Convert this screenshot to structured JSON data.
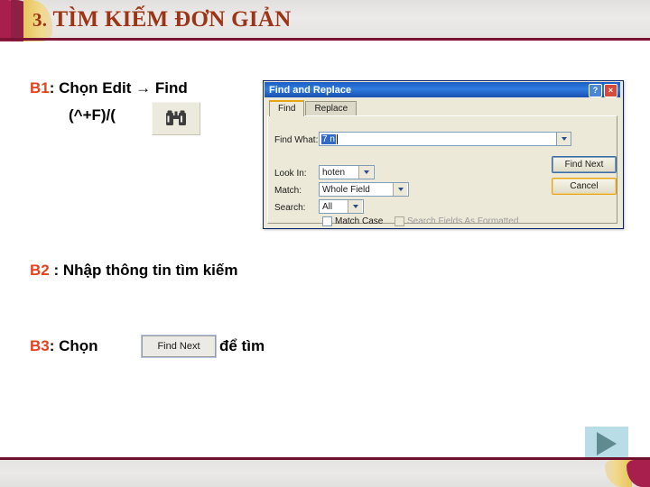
{
  "header": {
    "title_number": "3.",
    "title_text": " TÌM KIẾM ĐƠN GIẢN",
    "accent_maroon": "#8f1f45",
    "accent_gold": "#e8c45a",
    "title_color": "#9c3416"
  },
  "steps": {
    "b1": {
      "tag": "B1",
      "colon": ":",
      "line1": " Chọn Edit → Find",
      "line2": "(^+F)/(",
      "icon_name": "binoculars-icon"
    },
    "b2": {
      "tag": "B2",
      "colon": " :",
      "text": " Nhập thông tin tìm kiếm"
    },
    "b3": {
      "tag": "B3",
      "colon": ":",
      "text": "  Chọn",
      "button_label": "Find Next",
      "suffix": "để tìm"
    }
  },
  "dialog": {
    "title": "Find and Replace",
    "help_button": "?",
    "close_button": "×",
    "tabs": [
      {
        "label": "Find",
        "active": true
      },
      {
        "label": "Replace",
        "active": false
      }
    ],
    "find_what": {
      "label": "Find What:",
      "value": "7 n",
      "dropdown_arrow": "chevron-down-icon"
    },
    "look_in": {
      "label": "Look In:",
      "value": "hoten"
    },
    "match": {
      "label": "Match:",
      "value": "Whole Field"
    },
    "search": {
      "label": "Search:",
      "value": "All"
    },
    "checkboxes": [
      {
        "label": "Match Case",
        "checked": false,
        "disabled": false
      },
      {
        "label": "Search Fields As Formatted",
        "checked": false,
        "disabled": true
      }
    ],
    "buttons": {
      "find_next": "Find Next",
      "cancel": "Cancel"
    },
    "titlebar_color": "#2f7bdf",
    "body_color": "#ece9d8"
  },
  "footer": {
    "next_slide_icon": "play-triangle-icon",
    "rule_color": "#6e1230"
  }
}
